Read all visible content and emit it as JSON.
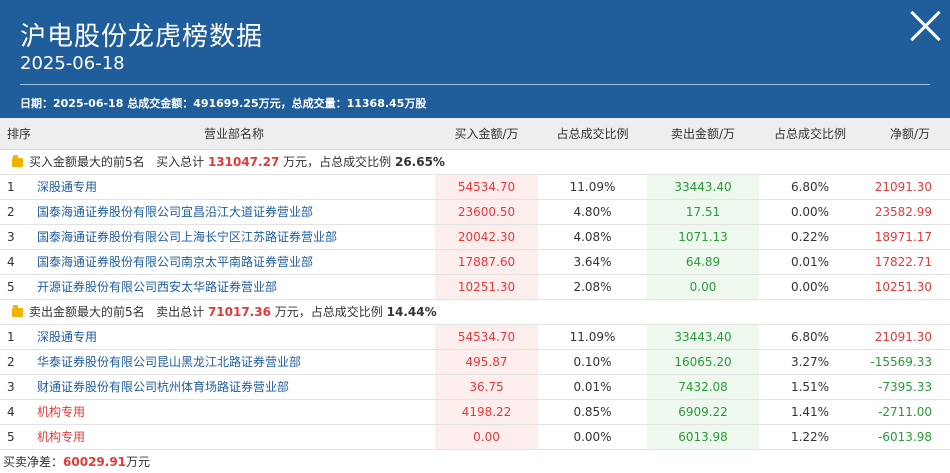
{
  "header": {
    "title": "沪电股份龙虎榜数据",
    "date": "2025-06-18",
    "summary": "日期：2025-06-18 总成交金额：491699.25万元，总成交量：11368.45万股"
  },
  "columns": [
    "排序",
    "营业部名称",
    "买入金额/万",
    "占总成交比例",
    "卖出金额/万",
    "占总成交比例",
    "净额/万"
  ],
  "buy_section": {
    "label": "买入金额最大的前5名",
    "total_label": "买入总计",
    "total": "131047.27",
    "unit_label": "万元，占总成交比例",
    "ratio": "26.65%",
    "rows": [
      {
        "rank": "1",
        "name": "深股通专用",
        "buy": "54534.70",
        "buy_pct": "11.09%",
        "sell": "33443.40",
        "sell_pct": "6.80%",
        "net": "21091.30"
      },
      {
        "rank": "2",
        "name": "国泰海通证券股份有限公司宜昌沿江大道证券营业部",
        "buy": "23600.50",
        "buy_pct": "4.80%",
        "sell": "17.51",
        "sell_pct": "0.00%",
        "net": "23582.99"
      },
      {
        "rank": "3",
        "name": "国泰海通证券股份有限公司上海长宁区江苏路证券营业部",
        "buy": "20042.30",
        "buy_pct": "4.08%",
        "sell": "1071.13",
        "sell_pct": "0.22%",
        "net": "18971.17"
      },
      {
        "rank": "4",
        "name": "国泰海通证券股份有限公司南京太平南路证券营业部",
        "buy": "17887.60",
        "buy_pct": "3.64%",
        "sell": "64.89",
        "sell_pct": "0.01%",
        "net": "17822.71"
      },
      {
        "rank": "5",
        "name": "开源证券股份有限公司西安太华路证券营业部",
        "buy": "10251.30",
        "buy_pct": "2.08%",
        "sell": "0.00",
        "sell_pct": "0.00%",
        "net": "10251.30"
      }
    ]
  },
  "sell_section": {
    "label": "卖出金额最大的前5名",
    "total_label": "卖出总计",
    "total": "71017.36",
    "unit_label": "万元，占总成交比例",
    "ratio": "14.44%",
    "rows": [
      {
        "rank": "1",
        "name": "深股通专用",
        "buy": "54534.70",
        "buy_pct": "11.09%",
        "sell": "33443.40",
        "sell_pct": "6.80%",
        "net": "21091.30"
      },
      {
        "rank": "2",
        "name": "华泰证券股份有限公司昆山黑龙江北路证券营业部",
        "buy": "495.87",
        "buy_pct": "0.10%",
        "sell": "16065.20",
        "sell_pct": "3.27%",
        "net": "-15569.33"
      },
      {
        "rank": "3",
        "name": "财通证券股份有限公司杭州体育场路证券营业部",
        "buy": "36.75",
        "buy_pct": "0.01%",
        "sell": "7432.08",
        "sell_pct": "1.51%",
        "net": "-7395.33"
      },
      {
        "rank": "4",
        "name": "机构专用",
        "buy": "4198.22",
        "buy_pct": "0.85%",
        "sell": "6909.22",
        "sell_pct": "1.41%",
        "net": "-2711.00"
      },
      {
        "rank": "5",
        "name": "机构专用",
        "buy": "0.00",
        "buy_pct": "0.00%",
        "sell": "6013.98",
        "sell_pct": "1.22%",
        "net": "-6013.98"
      }
    ]
  },
  "footer": {
    "label": "买卖净差：",
    "value": "60029.91",
    "unit": "万元"
  },
  "colors": {
    "header_bg": "#1f5d9b",
    "buy_red": "#e23a3a",
    "sell_green": "#2a9a3a",
    "section_icon": "#f0b400"
  }
}
